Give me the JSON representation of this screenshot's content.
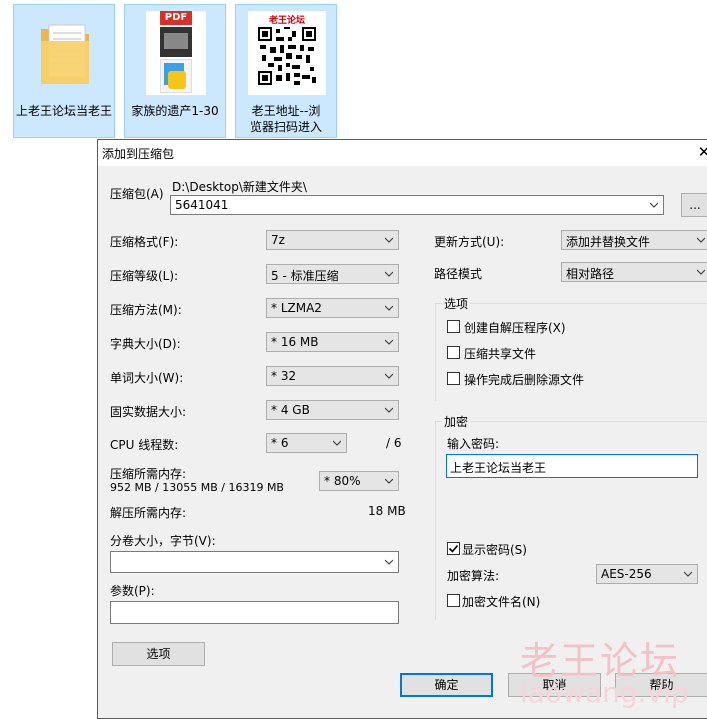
{
  "desktop": {
    "icons": [
      {
        "label": "上老王论坛当老王"
      },
      {
        "label": "家族的遗产1-30",
        "pdf_badge": "PDF"
      },
      {
        "label": "老王地址--浏览器扫码进入",
        "qr_header": "老王论坛"
      }
    ]
  },
  "dialog": {
    "title": "添加到压缩包",
    "archive_label": "压缩包(A)",
    "archive_path": "D:\\Desktop\\新建文件夹\\",
    "archive_name": "5641041",
    "browse_label": "...",
    "left": {
      "format_label": "压缩格式(F):",
      "format_value": "7z",
      "level_label": "压缩等级(L):",
      "level_value": "5 - 标准压缩",
      "method_label": "压缩方法(M):",
      "method_value": "* LZMA2",
      "dict_label": "字典大小(D):",
      "dict_value": "* 16 MB",
      "word_label": "单词大小(W):",
      "word_value": "* 32",
      "solid_label": "固实数据大小:",
      "solid_value": "* 4 GB",
      "threads_label": "CPU 线程数:",
      "threads_value": "* 6",
      "threads_total": "/ 6",
      "mem_label": "压缩所需内存:",
      "mem_detail": "952 MB / 13055 MB / 16319 MB",
      "mem_percent": "* 80%",
      "decomp_label": "解压所需内存:",
      "decomp_value": "18 MB",
      "split_label": "分卷大小，字节(V):",
      "split_value": "",
      "params_label": "参数(P):",
      "params_value": "",
      "options_button": "选项"
    },
    "right": {
      "update_label": "更新方式(U):",
      "update_value": "添加并替换文件",
      "path_label": "路径模式",
      "path_value": "相对路径",
      "options_group": "选项",
      "opt_sfx": "创建自解压程序(X)",
      "opt_shared": "压缩共享文件",
      "opt_delete": "操作完成后删除源文件",
      "encrypt_group": "加密",
      "password_label": "输入密码:",
      "password_value": "上老王论坛当老王",
      "show_password": "显示密码(S)",
      "show_password_checked": true,
      "algo_label": "加密算法:",
      "algo_value": "AES-256",
      "encrypt_names": "加密文件名(N)"
    },
    "buttons": {
      "ok": "确定",
      "cancel": "取消",
      "help": "帮助"
    }
  },
  "watermark": {
    "cn": "老王论坛",
    "en": "laowang.vip"
  }
}
